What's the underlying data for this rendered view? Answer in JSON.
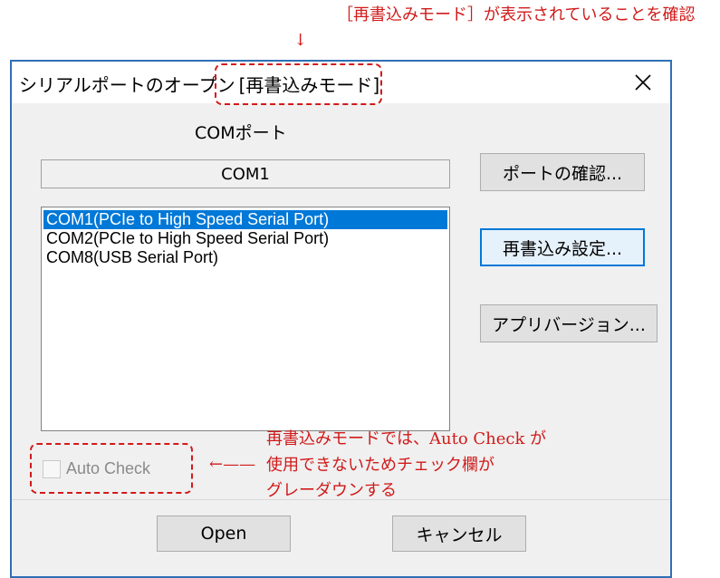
{
  "annotations": {
    "top_note": "［再書込みモード］が表示されていることを確認",
    "top_arrow": "↓",
    "side_arrow": "←——",
    "side_note_lines": [
      "再書込みモードでは、Auto Check が",
      "使用できないためチェック欄が",
      "グレーダウンする"
    ],
    "color": "#d11a1a"
  },
  "window": {
    "title": "シリアルポートのオープン",
    "mode": "[再書込みモード]",
    "close_symbol": "✕"
  },
  "port": {
    "section_label": "COMポート",
    "current_value": "COM1",
    "list": [
      "COM1(PCIe to High Speed Serial Port)",
      "COM2(PCIe to High Speed Serial Port)",
      "COM8(USB Serial Port)"
    ],
    "selected_index": 0
  },
  "buttons": {
    "check_port": "ポートの確認...",
    "rewrite_settings": "再書込み設定...",
    "app_version": "アプリバージョン...",
    "open": "Open",
    "cancel": "キャンセル"
  },
  "auto_check": {
    "label": "Auto Check",
    "checked": false,
    "disabled": true
  },
  "colors": {
    "window_border": "#2f6fb5",
    "selection": "#0078d7",
    "client_bg": "#f0f0f0"
  }
}
